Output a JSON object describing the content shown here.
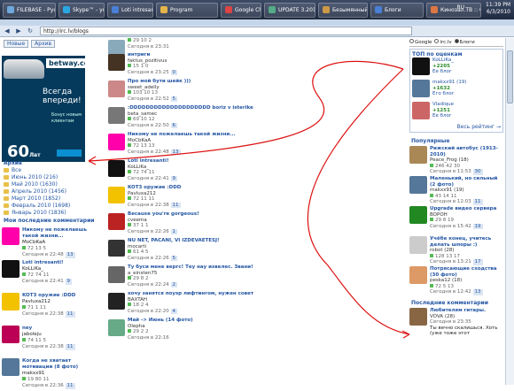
{
  "taskbar": {
    "items": [
      {
        "label": "FILEBASE - Русскоязычн...",
        "color": "#6fa8dc"
      },
      {
        "label": "Skype™ - yummc...",
        "color": "#2aa7e0"
      },
      {
        "label": "Loti intresanti!",
        "color": "#4a7fd6"
      },
      {
        "label": "Program",
        "color": "#e3b54b"
      },
      {
        "label": "Google Chr...",
        "color": "#d44"
      },
      {
        "label": "UPDATE 3.20100603.123",
        "color": "#5a8"
      },
      {
        "label": "Безымянный - Paint",
        "color": "#c94"
      },
      {
        "label": "Блоги",
        "color": "#4a7fd6"
      },
      {
        "label": "Кинозал.ТВ :: Скачать ф...",
        "color": "#d74"
      }
    ],
    "lang": "RU",
    "time": "11:39 PM",
    "date": "6/3/2010"
  },
  "browser": {
    "url": "http://irc.lv/blogs"
  },
  "left": {
    "tabs": [
      "Новые",
      "Архив"
    ],
    "banner": {
      "brand": "betway",
      "brand_suffix": ".com",
      "line1": "Всегда",
      "line2": "впереди!",
      "small": "Бонус новым клиентам",
      "amount": "60",
      "unit": "Лат"
    },
    "archive_title": "Архив",
    "archive": [
      "Все",
      "Июнь 2010 (216)",
      "Май 2010 (1630)",
      "Апрель 2010 (1456)",
      "Март 2010 (1852)",
      "Февраль 2010 (1698)",
      "Январь 2010 (1836)"
    ],
    "comments_title": "Мои последние комментарии",
    "comments": [
      {
        "title": "Никому не пожелаешь такой жизни...",
        "user": "MoCbKaA",
        "votes": "72",
        "c1": "13",
        "c2": "5",
        "time": "Сегодня в 22:48",
        "count": "13",
        "avc": "#f0a"
      },
      {
        "title": "Loti intresanti!",
        "user": "KoLLiKa_",
        "votes": "72",
        "c1": "74",
        "c2": "11",
        "time": "Сегодня в 22:41",
        "count": "9",
        "avc": "#111"
      },
      {
        "title": "KOT3 оружие :DDD",
        "user": "Pavluxa212",
        "votes": "71",
        "c1": "1",
        "c2": "11",
        "time": "Сегодня в 22:38",
        "count": "11",
        "avc": "#f2c200"
      },
      {
        "title": "ney",
        "user": "jaboleju",
        "votes": "74",
        "c1": "11",
        "c2": "5",
        "time": "Сегодня в 22:38",
        "count": "11",
        "avc": "#b05"
      },
      {
        "title": "Когда не хватает мотивации (8 фото)",
        "user": "makxx91",
        "votes": "19",
        "c1": "80",
        "c2": "11",
        "time": "Сегодня в 22:36",
        "count": "11",
        "avc": "#579"
      }
    ]
  },
  "main": {
    "posts": [
      {
        "title": "",
        "user": "",
        "votes": "29",
        "c1": "10",
        "c2": "2",
        "time": "Сегодня в 23:31",
        "count": "",
        "avc": "#8ab"
      },
      {
        "title": "интриги",
        "user": "faktus_pozitivus",
        "votes": "15",
        "c1": "1",
        "c2": "0",
        "time": "Сегодня в 23:25",
        "count": "0",
        "avc": "#432"
      },
      {
        "title": "Про мой бути шейк )))",
        "user": "sweet_adelly",
        "votes": "103",
        "c1": "10",
        "c2": "13",
        "time": "Сегодня в 22:52",
        "count": "5",
        "avc": "#c88"
      },
      {
        "title": ":DDDDDDDDDDDDDDDDDDDD boriz v isterike",
        "user": "beta_samec",
        "votes": "69",
        "c1": "10",
        "c2": "12",
        "time": "Сегодня в 22:50",
        "count": "6",
        "avc": "#777"
      },
      {
        "title": "Никому не пожелаешь такой жизни...",
        "user": "MoCbKaA",
        "votes": "72",
        "c1": "13",
        "c2": "13",
        "time": "Сегодня в 22:48",
        "count": "13",
        "avc": "#f0a"
      },
      {
        "title": "Loti intresanti!",
        "user": "KoLLiKa_",
        "votes": "72",
        "c1": "74",
        "c2": "11",
        "time": "Сегодня в 22:41",
        "count": "9",
        "avc": "#111"
      },
      {
        "title": "KOT3 оружие :DDD",
        "user": "Pavluxa212",
        "votes": "72",
        "c1": "11",
        "c2": "11",
        "time": "Сегодня в 22:38",
        "count": "11",
        "avc": "#f2c200"
      },
      {
        "title": "Because you're gorgeous!",
        "user": "cveema",
        "votes": "37",
        "c1": "1",
        "c2": "1",
        "time": "Сегодня в 22:26",
        "count": "1",
        "avc": "#b22"
      },
      {
        "title": "NU NET, PACANI, VI IZDEVAETESJ!",
        "user": "mocarti",
        "votes": "61",
        "c1": "4",
        "c2": "5",
        "time": "Сегодня в 22:26",
        "count": "5",
        "avc": "#333"
      },
      {
        "title": "Ту буси мене вергс! Теу нау извелес. Звани!",
        "user": "a_einsten75",
        "votes": "29",
        "c1": "8",
        "c2": "2",
        "time": "Сегодня в 22:24",
        "count": "2",
        "avc": "#666"
      },
      {
        "title": "хочу занятся поуэр лифтингом, нужен совет",
        "user": "BAXTAH",
        "votes": "18",
        "c1": "2",
        "c2": "4",
        "time": "Сегодня в 22:20",
        "count": "4",
        "avc": "#222"
      },
      {
        "title": "Май -> Июнь (14 фото)",
        "user": "Olepha",
        "votes": "29",
        "c1": "2",
        "c2": "2",
        "time": "Сегодня в 22:16",
        "count": "",
        "avc": "#6a8"
      }
    ]
  },
  "right": {
    "search_options": [
      "Google",
      "irc.lv",
      "Блоги"
    ],
    "top_title": "ТОП по оценкам",
    "top": [
      {
        "user": "KoLLiKa_",
        "votes": "+2205",
        "link": "Ее блог",
        "avc": "#111"
      },
      {
        "user": "makxx91 (19)",
        "votes": "+1632",
        "link": "Его блог",
        "avc": "#579"
      },
      {
        "user": "Vladique",
        "votes": "+1251",
        "link": "Ее блог",
        "avc": "#c66"
      }
    ],
    "top_more": "Весь рейтинг →",
    "pop_title": "Популярные",
    "popular": [
      {
        "title": "Рижский автобус (1913-2010)",
        "user": "Peace_Frog (18)",
        "votes": "246",
        "c1": "42",
        "c2": "30",
        "time": "Сегодня в 11:53",
        "count": "30",
        "avc": "#a85"
      },
      {
        "title": "Маленький, но сильный (2 фото)",
        "user": "makxx91 (19)",
        "votes": "43",
        "c1": "14",
        "c2": "11",
        "time": "Сегодня в 12:03",
        "count": "11",
        "avc": "#579"
      },
      {
        "title": "Upgrade видео сервера",
        "user": "BOPOH",
        "votes": "29",
        "c1": "8",
        "c2": "19",
        "time": "Сегодня в 15:42",
        "count": "19",
        "avc": "#282"
      },
      {
        "title": "Учёбе конец, учитесь делать шпоры :)",
        "user": "robot (28)",
        "votes": "128",
        "c1": "13",
        "c2": "17",
        "time": "Сегодня в 13:21",
        "count": "17",
        "avc": "#ccc"
      },
      {
        "title": "Потрясающие сходства (30 фото)",
        "user": "peska12 (18)",
        "votes": "72",
        "c1": "5",
        "c2": "13",
        "time": "Сегодня в 12:42",
        "count": "13",
        "avc": "#d96"
      }
    ],
    "last_comments_title": "Последние комментарии",
    "last_comment": {
      "title": "Любителям гитары.",
      "user": "VOVA (28)",
      "time": "Сегодня в 23:35",
      "count": "9",
      "text": "Ты вечно скалишься. Хоть (уже тоже этот",
      "avc": "#864"
    }
  }
}
